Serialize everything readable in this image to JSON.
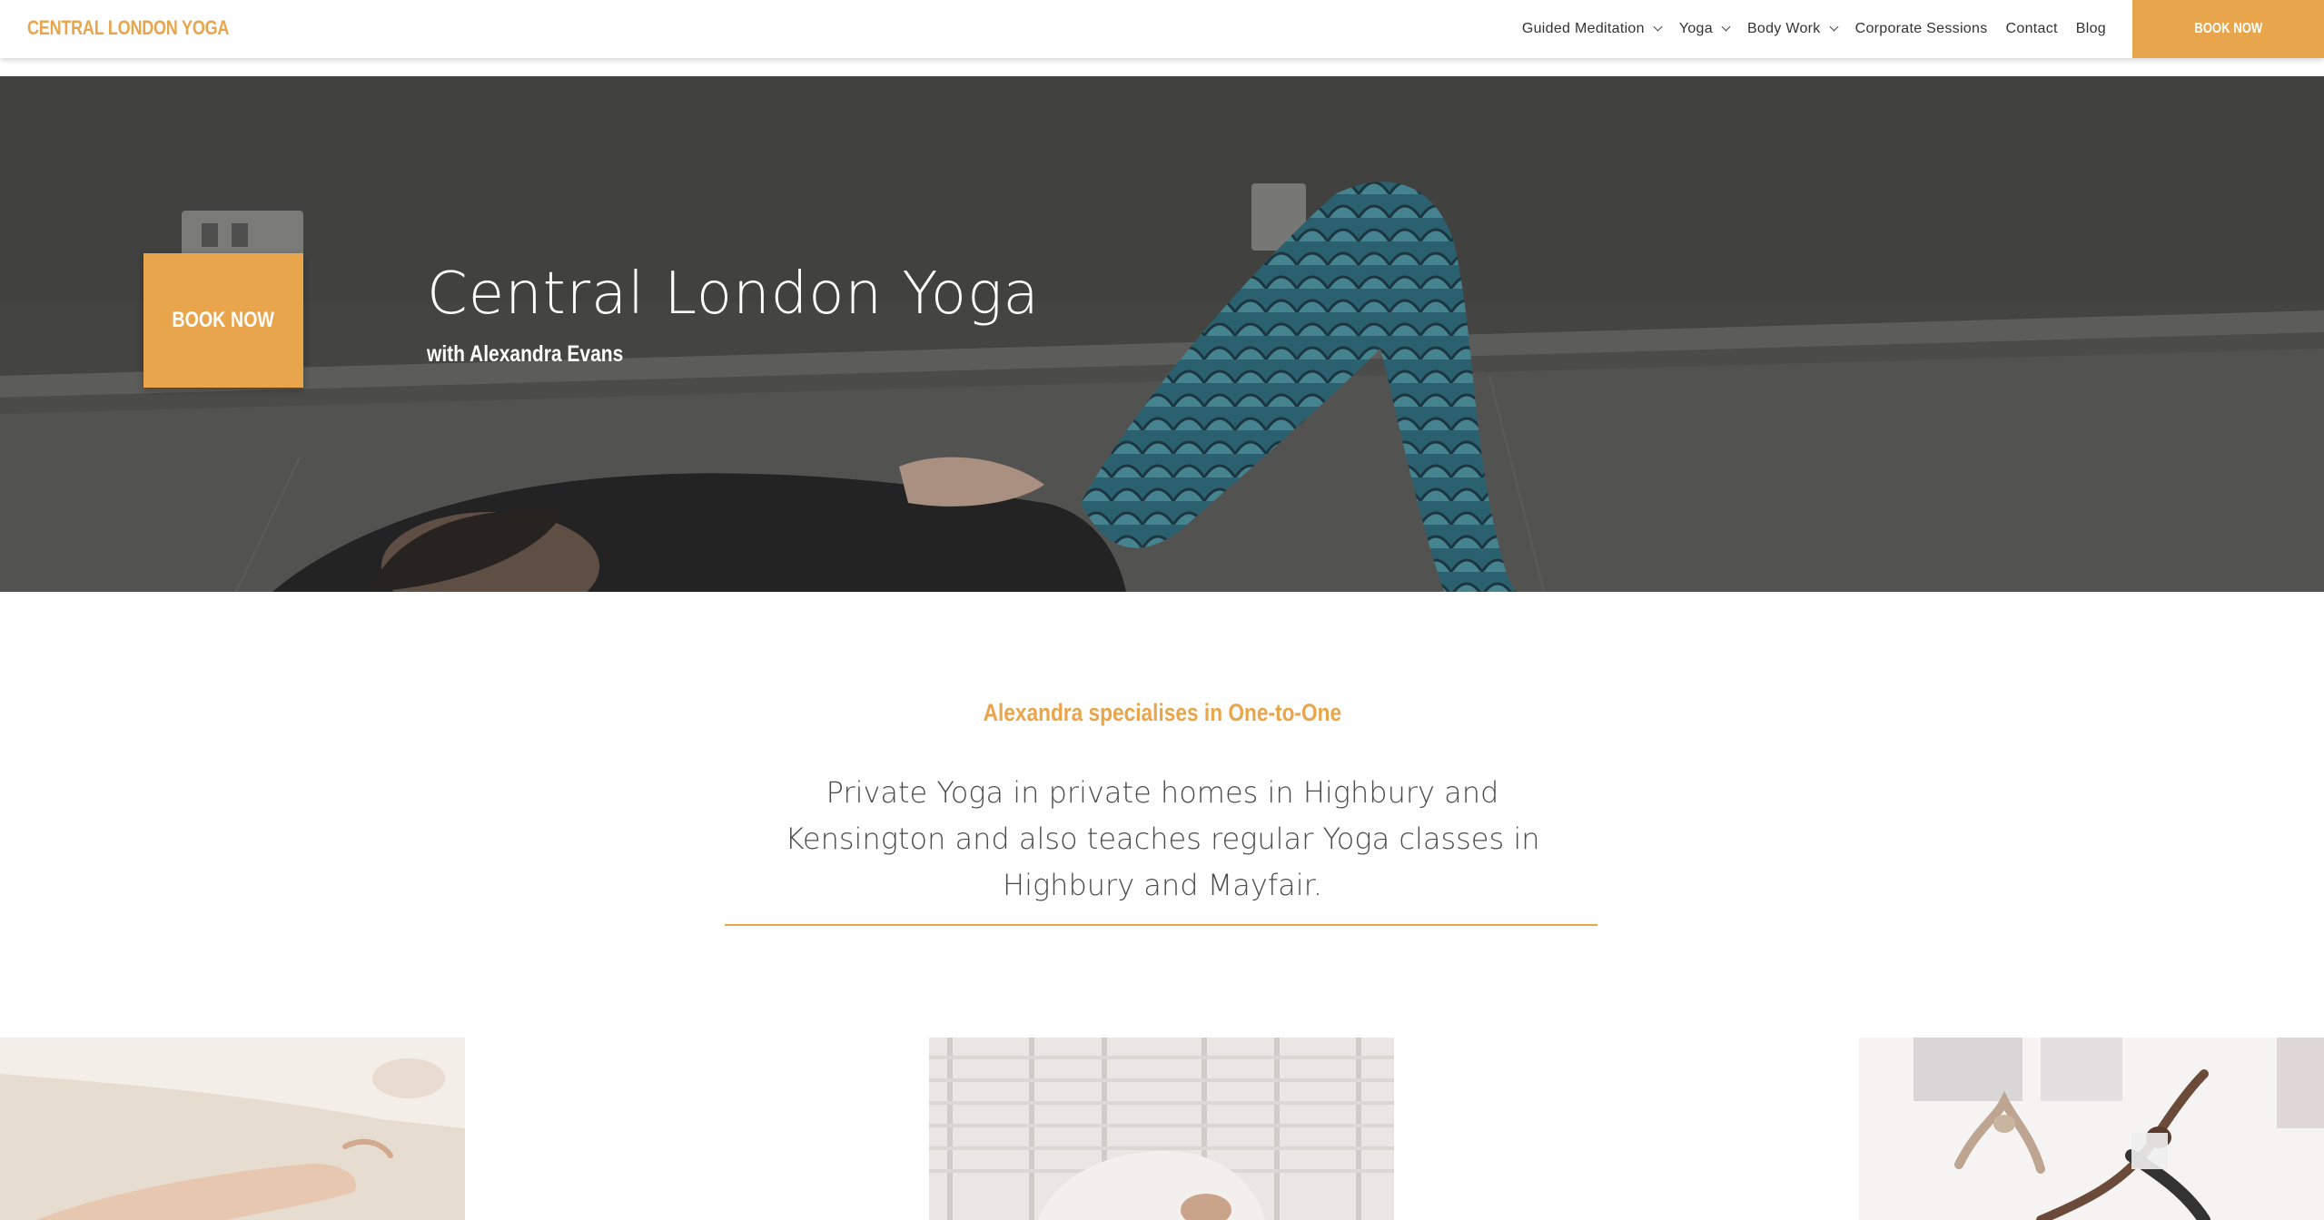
{
  "brand": {
    "logo_text": "CENTRAL LONDON YOGA",
    "accent_color": "#e8a54b"
  },
  "nav": {
    "items": [
      {
        "label": "Guided Meditation",
        "has_dropdown": true
      },
      {
        "label": "Yoga",
        "has_dropdown": true
      },
      {
        "label": "Body Work",
        "has_dropdown": true
      },
      {
        "label": "Corporate Sessions",
        "has_dropdown": false
      },
      {
        "label": "Contact",
        "has_dropdown": false
      },
      {
        "label": "Blog",
        "has_dropdown": false
      }
    ],
    "book_label": "BOOK NOW"
  },
  "hero": {
    "book_label": "BOOK NOW",
    "title": "Central London Yoga",
    "subtitle": "with Alexandra Evans"
  },
  "intro": {
    "heading": "Alexandra specialises in One-to-One",
    "body": "Private Yoga in private homes in Highbury and Kensington and also teaches regular Yoga classes in Highbury and Mayfair."
  },
  "gallery": {
    "images": [
      {
        "icon": "meditation-hands-photo"
      },
      {
        "icon": "child-pose-photo"
      },
      {
        "icon": "yoga-class-photo"
      }
    ]
  }
}
